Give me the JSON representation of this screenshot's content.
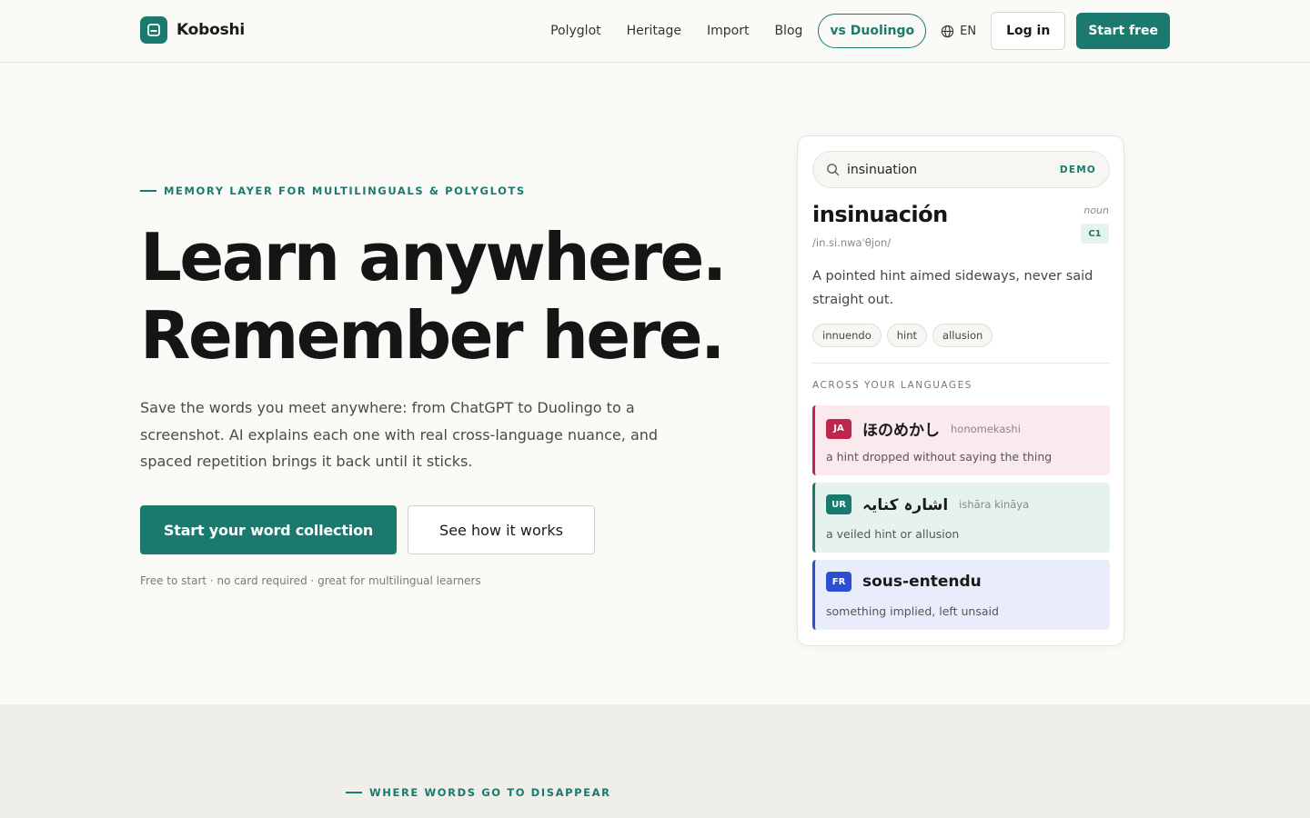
{
  "brand": {
    "name": "Koboshi"
  },
  "nav": {
    "links": [
      "Polyglot",
      "Heritage",
      "Import",
      "Blog"
    ],
    "compare": "vs Duolingo",
    "language": "EN",
    "login": "Log in",
    "start": "Start free"
  },
  "hero": {
    "eyebrow": "MEMORY LAYER FOR MULTILINGUALS & POLYGLOTS",
    "headline_line1": "Learn anywhere.",
    "headline_line2": "Remember here.",
    "lede": "Save the words you meet anywhere: from ChatGPT to Duolingo to a screenshot. AI explains each one with real cross-language nuance, and spaced repetition brings it back until it sticks.",
    "cta_primary": "Start your word collection",
    "cta_secondary": "See how it works",
    "fineprint": "Free to start · no card required · great for multilingual learners"
  },
  "demo": {
    "query": "insinuation",
    "badge": "DEMO",
    "word": "insinuación",
    "part_of_speech": "noun",
    "level": "C1",
    "ipa": "/in.si.nwaˈθjon/",
    "definition": "A pointed hint aimed sideways, never said straight out.",
    "tags": [
      "innuendo",
      "hint",
      "allusion"
    ],
    "across_label": "ACROSS YOUR LANGUAGES",
    "languages": [
      {
        "code": "JA",
        "word": "ほのめかし",
        "roman": "honomekashi",
        "gloss": "a hint dropped without saying the thing",
        "color": "#c0254e"
      },
      {
        "code": "UR",
        "word": "اشارہ کنایہ",
        "roman": "ishāra kināya",
        "gloss": "a veiled hint or allusion",
        "color": "#1a7a6e"
      },
      {
        "code": "FR",
        "word": "sous-entendu",
        "roman": "",
        "gloss": "something implied, left unsaid",
        "color": "#2c4fd1"
      }
    ]
  },
  "section2": {
    "eyebrow": "WHERE WORDS GO TO DISAPPEAR"
  },
  "colors": {
    "accent": "#1a7a6e",
    "background": "#fafaf7"
  }
}
